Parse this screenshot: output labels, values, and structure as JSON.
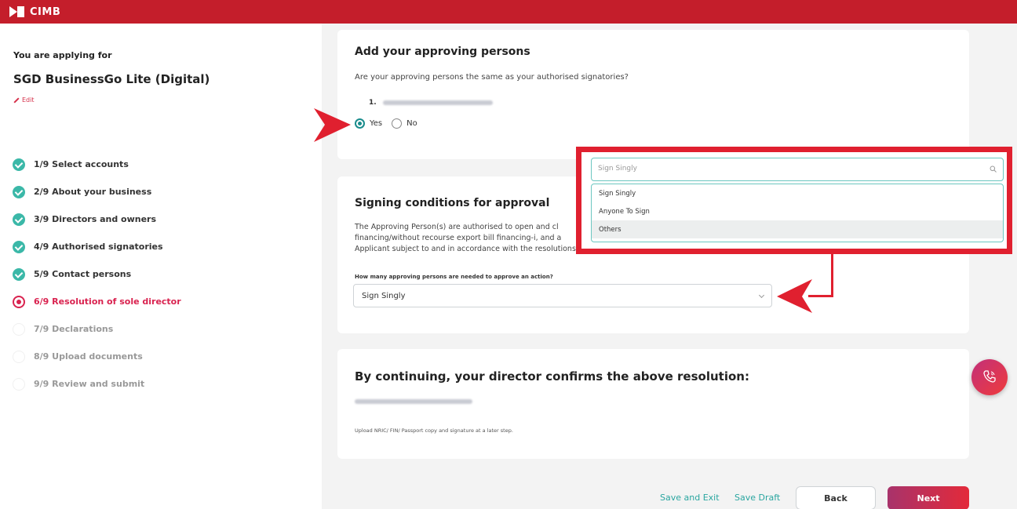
{
  "app": {
    "brand": "CIMB"
  },
  "sidebar": {
    "applying_label": "You are applying for",
    "product_name": "SGD BusinessGo Lite (Digital)",
    "edit_label": "Edit",
    "steps": [
      {
        "label": "1/9 Select accounts",
        "status": "done"
      },
      {
        "label": "2/9 About your business",
        "status": "done"
      },
      {
        "label": "3/9 Directors and owners",
        "status": "done"
      },
      {
        "label": "4/9 Authorised signatories",
        "status": "done"
      },
      {
        "label": "5/9 Contact persons",
        "status": "done"
      },
      {
        "label": "6/9 Resolution of sole director",
        "status": "current"
      },
      {
        "label": "7/9 Declarations",
        "status": "todo"
      },
      {
        "label": "8/9 Upload documents",
        "status": "todo"
      },
      {
        "label": "9/9 Review and submit",
        "status": "todo"
      }
    ]
  },
  "approving": {
    "title": "Add your approving persons",
    "question": "Are your approving persons the same as your authorised signatories?",
    "person_index": "1.",
    "yes_label": "Yes",
    "no_label": "No",
    "selected": "Yes"
  },
  "signing": {
    "title": "Signing conditions for approval",
    "desc_line1": "The Approving Person(s) are authorised to open and cl",
    "desc_line2": "financing/without recourse export bill financing-i, and a",
    "desc_line3": "Applicant subject to and in accordance with the resolutions to which this list is attached.",
    "field_label": "How many approving persons are needed to approve an action?",
    "selected_value": "Sign Singly"
  },
  "dropdown": {
    "search_placeholder": "Sign Singly",
    "options": [
      "Sign Singly",
      "Anyone To Sign",
      "Others"
    ],
    "highlighted": "Others"
  },
  "confirm": {
    "title": "By continuing, your director confirms the above resolution:",
    "upload_note": "Upload NRIC/ FIN/ Passport copy and signature at a later step."
  },
  "footer": {
    "save_exit": "Save and Exit",
    "save_draft": "Save Draft",
    "back": "Back",
    "next": "Next"
  },
  "colors": {
    "brand_red": "#c41e2b",
    "teal": "#3bb8a8",
    "current_step": "#d9224f",
    "annotation_red": "#e0202f"
  }
}
